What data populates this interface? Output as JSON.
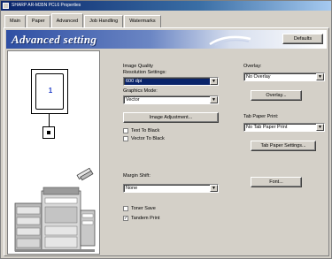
{
  "window": {
    "title": "SHARP AR-M35N PCL6 Properties"
  },
  "tabs": [
    {
      "label": "Main"
    },
    {
      "label": "Paper"
    },
    {
      "label": "Advanced"
    },
    {
      "label": "Job Handling"
    },
    {
      "label": "Watermarks"
    }
  ],
  "banner": {
    "title": "Advanced setting",
    "defaults_label": "Defaults"
  },
  "preview": {
    "page_number": "1"
  },
  "image_quality": {
    "heading": "Image Quality",
    "resolution_label": "Resolution Settings:",
    "resolution_value": "600 dpi",
    "graphics_label": "Graphics Mode:",
    "graphics_value": "Vector",
    "adjustment_button": "Image Adjustment...",
    "text_to_black": "Text To Black",
    "vector_to_black": "Vector To Black"
  },
  "margin_shift": {
    "label": "Margin Shift:",
    "value": "None"
  },
  "toner_save": {
    "label": "Toner Save",
    "checked": false
  },
  "tandem_print": {
    "label": "Tandem Print",
    "checked": true
  },
  "overlay": {
    "label": "Overlay:",
    "value": "No Overlay",
    "button": "Overlay..."
  },
  "tab_paper": {
    "label": "Tab Paper Print:",
    "value": "No Tab Paper Print",
    "button": "Tab Paper Settings..."
  },
  "fonts_button": "Font..."
}
